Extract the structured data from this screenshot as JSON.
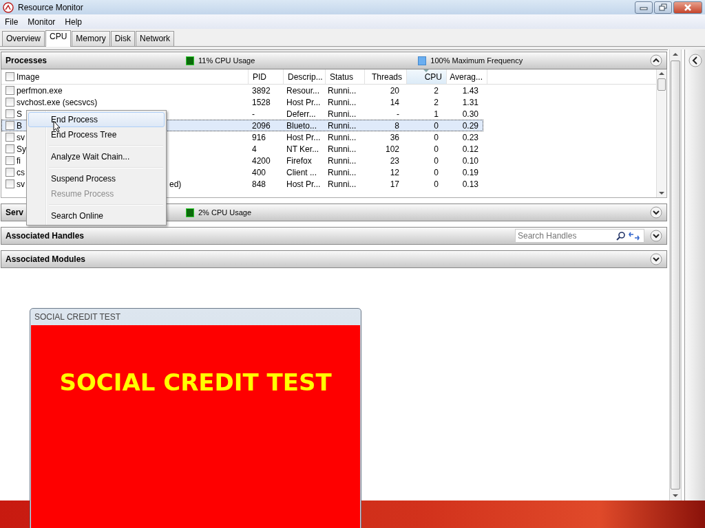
{
  "window": {
    "title": "Resource Monitor"
  },
  "menu": [
    "File",
    "Monitor",
    "Help"
  ],
  "tabs": [
    {
      "label": "Overview",
      "selected": false
    },
    {
      "label": "CPU",
      "selected": true
    },
    {
      "label": "Memory",
      "selected": false
    },
    {
      "label": "Disk",
      "selected": false
    },
    {
      "label": "Network",
      "selected": false
    }
  ],
  "processes": {
    "title": "Processes",
    "usage": "11% CPU Usage",
    "frequency": "100% Maximum Frequency",
    "expanded": true,
    "all_checked": false,
    "columns": [
      {
        "label": "Image",
        "sorted": false
      },
      {
        "label": "PID",
        "sorted": false
      },
      {
        "label": "Descrip...",
        "sorted": false
      },
      {
        "label": "Status",
        "sorted": false
      },
      {
        "label": "Threads",
        "sorted": false
      },
      {
        "label": "CPU",
        "sorted": true
      },
      {
        "label": "Averag...",
        "sorted": false
      }
    ],
    "rows": [
      {
        "checked": false,
        "selected": false,
        "image": "perfmon.exe",
        "pid": "3892",
        "description": "Resour...",
        "status": "Runni...",
        "threads": "20",
        "cpu": "2",
        "average": "1.43"
      },
      {
        "checked": false,
        "selected": false,
        "image": "svchost.exe (secsvcs)",
        "pid": "1528",
        "description": "Host Pr...",
        "status": "Runni...",
        "threads": "14",
        "cpu": "2",
        "average": "1.31"
      },
      {
        "checked": false,
        "selected": false,
        "image": "S",
        "pid": "-",
        "description": "Deferr...",
        "status": "Runni...",
        "threads": "-",
        "cpu": "1",
        "average": "0.30"
      },
      {
        "checked": false,
        "selected": true,
        "image": "B",
        "pid": "2096",
        "description": "Blueto...",
        "status": "Runni...",
        "threads": "8",
        "cpu": "0",
        "average": "0.29"
      },
      {
        "checked": false,
        "selected": false,
        "image": "sv",
        "pid": "916",
        "description": "Host Pr...",
        "status": "Runni...",
        "threads": "36",
        "cpu": "0",
        "average": "0.23"
      },
      {
        "checked": false,
        "selected": false,
        "image": "Sy",
        "pid": "4",
        "description": "NT Ker...",
        "status": "Runni...",
        "threads": "102",
        "cpu": "0",
        "average": "0.12"
      },
      {
        "checked": false,
        "selected": false,
        "image": "fi",
        "pid": "4200",
        "description": "Firefox",
        "status": "Runni...",
        "threads": "23",
        "cpu": "0",
        "average": "0.10"
      },
      {
        "checked": false,
        "selected": false,
        "image": "cs",
        "pid": "400",
        "description": "Client ...",
        "status": "Runni...",
        "threads": "12",
        "cpu": "0",
        "average": "0.19"
      },
      {
        "checked": false,
        "selected": false,
        "image": "sv",
        "image_tail": "ed)",
        "pid": "848",
        "description": "Host Pr...",
        "status": "Runni...",
        "threads": "17",
        "cpu": "0",
        "average": "0.13"
      }
    ]
  },
  "sections": [
    {
      "title": "Serv",
      "usage": "2% CPU Usage",
      "expanded": false
    },
    {
      "title": "Associated Handles",
      "search": {
        "placeholder": "Search Handles"
      },
      "expanded": false
    },
    {
      "title": "Associated Modules",
      "expanded": false
    }
  ],
  "context_menu": {
    "items": [
      {
        "kind": "item",
        "label": "End Process",
        "highlighted": true,
        "disabled": false
      },
      {
        "kind": "item",
        "label": "End Process Tree",
        "highlighted": false,
        "disabled": false
      },
      {
        "kind": "separator"
      },
      {
        "kind": "item",
        "label": "Analyze Wait Chain...",
        "highlighted": false,
        "disabled": false
      },
      {
        "kind": "separator"
      },
      {
        "kind": "item",
        "label": "Suspend Process",
        "highlighted": false,
        "disabled": false
      },
      {
        "kind": "item",
        "label": "Resume Process",
        "highlighted": false,
        "disabled": true
      },
      {
        "kind": "separator"
      },
      {
        "kind": "item",
        "label": "Search Online",
        "highlighted": false,
        "disabled": false
      }
    ]
  },
  "dialog": {
    "title": "SOCIAL CREDIT TEST",
    "heading": "SOCIAL CREDIT TEST"
  }
}
